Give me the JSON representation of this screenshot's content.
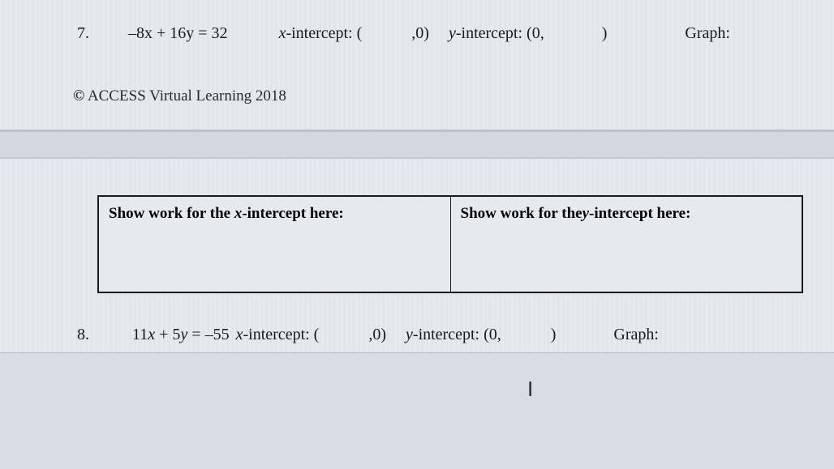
{
  "problem7": {
    "number": "7.",
    "equation": "–8x + 16y = 32",
    "x_int_label": "x-intercept: (",
    "x_int_after": ",0)",
    "y_int_label": "y-intercept: (0,",
    "y_int_after": ")",
    "graph_label": "Graph:"
  },
  "copyright": {
    "symbol": "©",
    "text": "ACCESS Virtual Learning 2018"
  },
  "work_table": {
    "x_prompt_prefix": "Show work for the ",
    "x_prompt_var": "x",
    "x_prompt_suffix": "-intercept here:",
    "y_prompt_prefix": "Show work for the",
    "y_prompt_var": "y",
    "y_prompt_suffix": "-intercept here:"
  },
  "cursor": "I",
  "problem8": {
    "number": "8.",
    "equation": "11x + 5y = –55",
    "x_int_label": "x-intercept: (",
    "x_int_after": ",0)",
    "y_int_label": "y-intercept: (0,",
    "y_int_after": ")",
    "graph_label": "Graph:"
  }
}
